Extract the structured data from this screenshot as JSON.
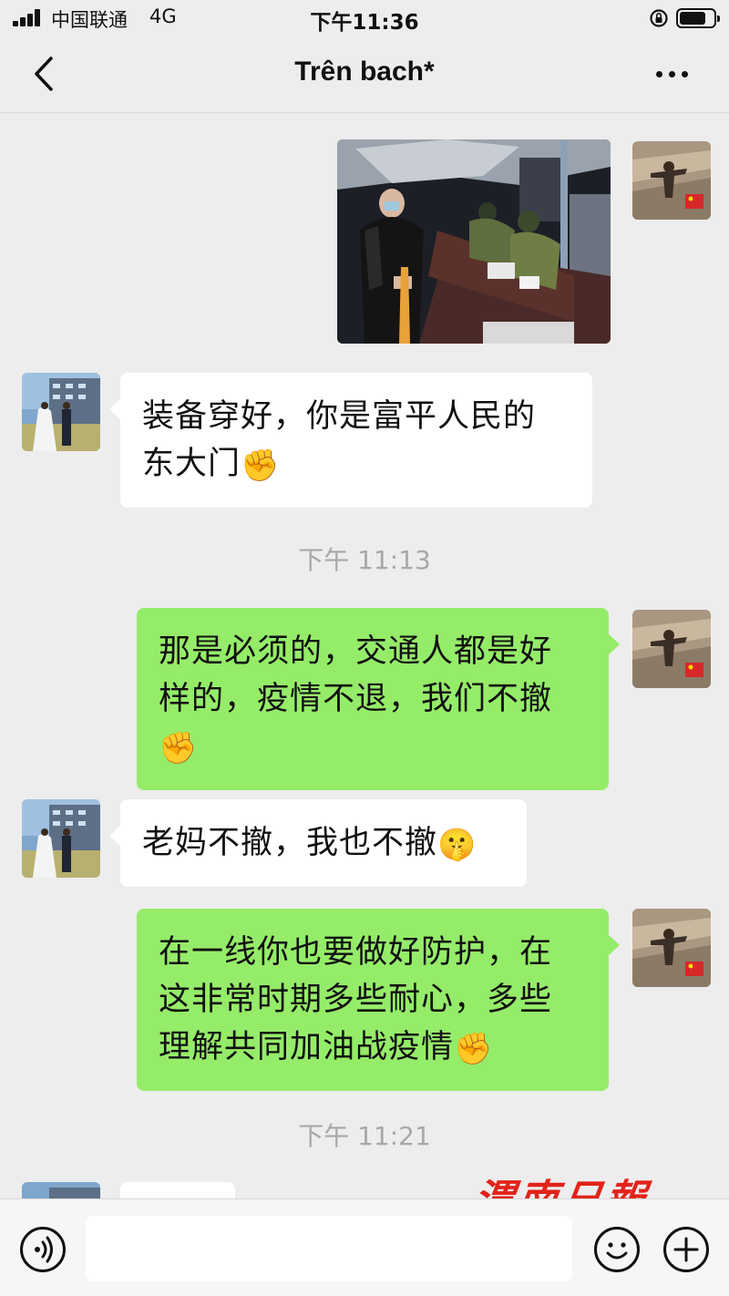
{
  "status_bar": {
    "carrier": "中国联通",
    "network": "4G",
    "time": "下午11:36"
  },
  "nav": {
    "title": "Trên bach*"
  },
  "messages": [
    {
      "side": "out",
      "type": "image",
      "sender": "me"
    },
    {
      "side": "in",
      "type": "text",
      "line1": "装备穿好，你是富平人民的",
      "line2": "东大门",
      "emoji": "✊"
    },
    {
      "type": "time",
      "text": "下午 11:13"
    },
    {
      "side": "out",
      "type": "text",
      "line1": "那是必须的，交通人都是好",
      "line2": "样的，疫情不退，我们不撤",
      "emoji": "✊"
    },
    {
      "side": "in",
      "type": "text",
      "line1": "老妈不撤，我也不撤",
      "emoji": "🤫"
    },
    {
      "side": "out",
      "type": "text",
      "line1": "在一线你也要做好防护，在",
      "line2": "这非常时期多些耐心，多些",
      "line3": "理解共同加油战疫情",
      "emoji": "✊"
    },
    {
      "type": "time",
      "text": "下午 11:21"
    }
  ],
  "watermark": "渭南日報",
  "colors": {
    "incoming_bubble": "#ffffff",
    "outgoing_bubble": "#95ec69",
    "background": "#ededed",
    "watermark": "#e2231a"
  },
  "icons": {
    "back": "chevron-left-icon",
    "more": "more-dots-icon",
    "voice": "voice-icon",
    "emoji": "emoji-icon",
    "plus": "plus-icon"
  }
}
